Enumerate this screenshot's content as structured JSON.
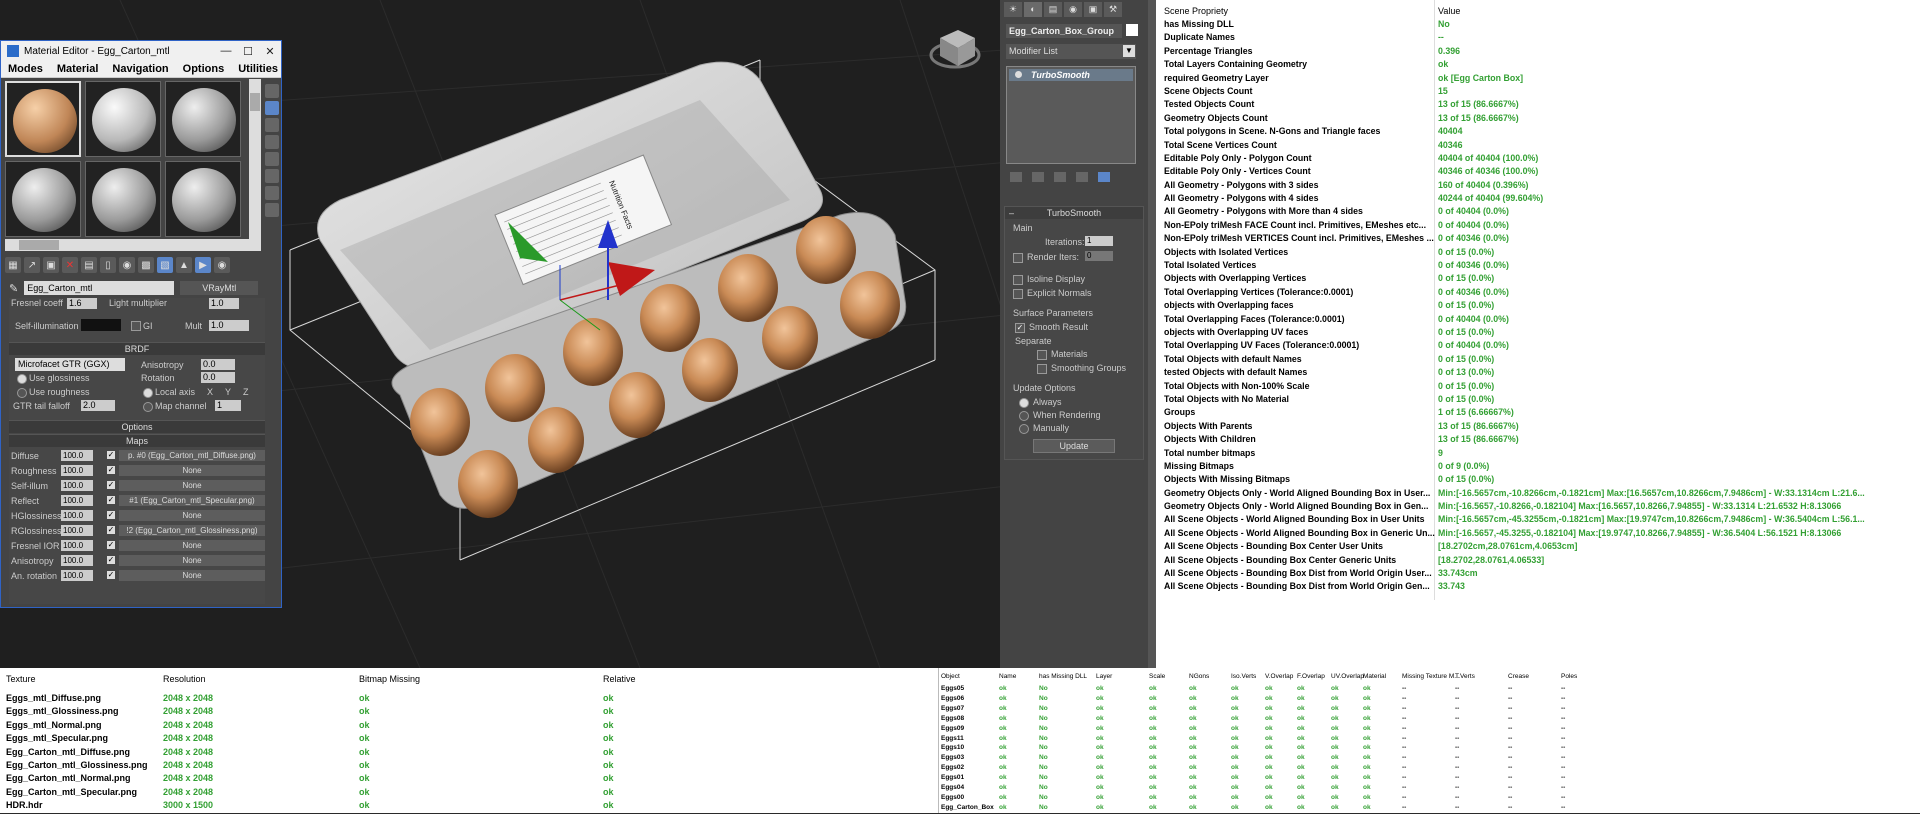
{
  "material_editor": {
    "title": "Material Editor - Egg_Carton_mtl",
    "menu": [
      "Modes",
      "Material",
      "Navigation",
      "Options",
      "Utilities"
    ],
    "material_name": "Egg_Carton_mtl",
    "material_type": "VRayMtl",
    "top_partial_labels": [
      "Fresnel coeff",
      "Light multiplier"
    ],
    "top_partial_values": [
      "1.6",
      "1.0"
    ],
    "self_illum_label": "Self-illumination",
    "gi_label": "GI",
    "mult_label": "Mult",
    "mult_value": "1.0",
    "brdf": {
      "header": "BRDF",
      "type": "Microfacet GTR (GGX)",
      "use_glossiness": "Use glossiness",
      "use_roughness": "Use roughness",
      "anisotropy_label": "Anisotropy",
      "anisotropy_value": "0.0",
      "rotation_label": "Rotation",
      "rotation_value": "0.0",
      "local_axis": "Local axis",
      "axes": [
        "X",
        "Y",
        "Z"
      ],
      "gtr_label": "GTR tail falloff",
      "gtr_value": "2.0",
      "map_channel_label": "Map channel",
      "map_channel_value": "1"
    },
    "options_header": "Options",
    "maps_header": "Maps",
    "maps": [
      {
        "name": "Diffuse",
        "value": "100.0",
        "slot": "p. #0 (Egg_Carton_mtl_Diffuse.png)"
      },
      {
        "name": "Roughness",
        "value": "100.0",
        "slot": "None"
      },
      {
        "name": "Self-illum",
        "value": "100.0",
        "slot": "None"
      },
      {
        "name": "Reflect",
        "value": "100.0",
        "slot": "#1 (Egg_Carton_mtl_Specular.png)"
      },
      {
        "name": "HGlossiness",
        "value": "100.0",
        "slot": "None"
      },
      {
        "name": "RGlossiness",
        "value": "100.0",
        "slot": "!2 (Egg_Carton_mtl_Glossiness.png)"
      },
      {
        "name": "Fresnel IOR",
        "value": "100.0",
        "slot": "None"
      },
      {
        "name": "Anisotropy",
        "value": "100.0",
        "slot": "None"
      },
      {
        "name": "An. rotation",
        "value": "100.0",
        "slot": "None"
      }
    ]
  },
  "command_panel": {
    "object_name": "Egg_Carton_Box_Group",
    "modifier_list": "Modifier List",
    "modifier": "TurboSmooth",
    "rollout_title": "TurboSmooth",
    "main_label": "Main",
    "iterations_label": "Iterations:",
    "iterations_value": "1",
    "render_iters_label": "Render Iters:",
    "render_iters_value": "0",
    "isoline_label": "Isoline Display",
    "explicit_normals_label": "Explicit Normals",
    "surface_params_label": "Surface Parameters",
    "smooth_result_label": "Smooth Result",
    "separate_label": "Separate",
    "materials_label": "Materials",
    "smoothing_groups_label": "Smoothing Groups",
    "update_options_label": "Update Options",
    "always_label": "Always",
    "when_rendering_label": "When Rendering",
    "manually_label": "Manually",
    "update_button": "Update"
  },
  "scene_properties": {
    "col_property": "Scene Propriety",
    "col_value": "Value",
    "rows": [
      [
        "has Missing DLL",
        "No"
      ],
      [
        "Duplicate Names",
        "--"
      ],
      [
        "Percentage Triangles",
        "0.396"
      ],
      [
        "Total Layers Containing Geometry",
        "ok"
      ],
      [
        "required Geometry Layer",
        "ok [Egg Carton Box]"
      ],
      [
        "Scene Objects Count",
        "15"
      ],
      [
        "Tested Objects Count",
        "13 of 15 (86.6667%)"
      ],
      [
        "Geometry Objects Count",
        "13 of 15 (86.6667%)"
      ],
      [
        "Total polygons in Scene. N-Gons and Triangle faces",
        "40404"
      ],
      [
        "Total Scene Vertices Count",
        "40346"
      ],
      [
        "Editable Poly Only - Polygon Count",
        "40404 of 40404 (100.0%)"
      ],
      [
        "Editable Poly Only - Vertices Count",
        "40346 of 40346 (100.0%)"
      ],
      [
        "All Geometry - Polygons with 3 sides",
        "160 of 40404 (0.396%)"
      ],
      [
        "All Geometry - Polygons with 4 sides",
        "40244 of 40404 (99.604%)"
      ],
      [
        "All Geometry - Polygons with More than 4 sides",
        "0 of 40404 (0.0%)"
      ],
      [
        "Non-EPoly triMesh FACE Count incl. Primitives, EMeshes etc...",
        "0 of 40404 (0.0%)"
      ],
      [
        "Non-EPoly triMesh VERTICES Count incl. Primitives, EMeshes ...",
        "0 of 40346 (0.0%)"
      ],
      [
        "Objects with Isolated Vertices",
        "0 of 15 (0.0%)"
      ],
      [
        "Total Isolated Vertices",
        "0 of 40346 (0.0%)"
      ],
      [
        "Objects with Overlapping Vertices",
        "0 of 15 (0.0%)"
      ],
      [
        "Total Overlapping Vertices (Tolerance:0.0001)",
        "0 of 40346 (0.0%)"
      ],
      [
        "objects with Overlapping faces",
        "0 of 15 (0.0%)"
      ],
      [
        "Total Overlapping Faces (Tolerance:0.0001)",
        "0 of 40404 (0.0%)"
      ],
      [
        "objects with Overlapping UV faces",
        "0 of 15 (0.0%)"
      ],
      [
        "Total Overlapping UV Faces (Tolerance:0.0001)",
        "0 of 40404 (0.0%)"
      ],
      [
        "Total Objects with default Names",
        "0 of 15 (0.0%)"
      ],
      [
        "tested Objects with default Names",
        "0 of 13 (0.0%)"
      ],
      [
        "Total Objects with Non-100% Scale",
        "0 of 15 (0.0%)"
      ],
      [
        "Total Objects with No Material",
        "0 of 15 (0.0%)"
      ],
      [
        "Groups",
        "1 of 15 (6.66667%)"
      ],
      [
        "Objects With Parents",
        "13 of 15 (86.6667%)"
      ],
      [
        "Objects With Children",
        "13 of 15 (86.6667%)"
      ],
      [
        "Total number bitmaps",
        "9"
      ],
      [
        "Missing Bitmaps",
        "0 of 9 (0.0%)"
      ],
      [
        "Objects With Missing Bitmaps",
        "0 of 15 (0.0%)"
      ],
      [
        "Geometry Objects Only - World Aligned Bounding Box in User...",
        "Min:[-16.5657cm,-10.8266cm,-0.1821cm]  Max:[16.5657cm,10.8266cm,7.9486cm] - W:33.1314cm L:21.6..."
      ],
      [
        "Geometry Objects Only - World Aligned Bounding Box in Gen...",
        "Min:[-16.5657,-10.8266,-0.182104]  Max:[16.5657,10.8266,7.94855] - W:33.1314 L:21.6532 H:8.13066"
      ],
      [
        "All Scene Objects - World Aligned Bounding Box in User Units",
        "Min:[-16.5657cm,-45.3255cm,-0.1821cm]  Max:[19.9747cm,10.8266cm,7.9486cm] - W:36.5404cm L:56.1..."
      ],
      [
        "All Scene Objects - World Aligned Bounding Box in Generic Un...",
        "Min:[-16.5657,-45.3255,-0.182104]  Max:[19.9747,10.8266,7.94855] - W:36.5404 L:56.1521 H:8.13066"
      ],
      [
        "All Scene Objects - Bounding Box Center User Units",
        "[18.2702cm,28.0761cm,4.0653cm]"
      ],
      [
        "All Scene Objects - Bounding Box Center Generic Units",
        "[18.2702,28.0761,4.06533]"
      ],
      [
        "All Scene Objects - Bounding Box Dist from World Origin User...",
        "33.743cm"
      ],
      [
        "All Scene Objects - Bounding Box Dist from World Origin Gen...",
        "33.743"
      ]
    ]
  },
  "textures": {
    "headers": [
      "Texture",
      "Resolution",
      "Bitmap Missing",
      "Relative"
    ],
    "rows": [
      [
        "Eggs_mtl_Diffuse.png",
        "2048 x 2048",
        "ok",
        "ok"
      ],
      [
        "Eggs_mtl_Glossiness.png",
        "2048 x 2048",
        "ok",
        "ok"
      ],
      [
        "Eggs_mtl_Normal.png",
        "2048 x 2048",
        "ok",
        "ok"
      ],
      [
        "Eggs_mtl_Specular.png",
        "2048 x 2048",
        "ok",
        "ok"
      ],
      [
        "Egg_Carton_mtl_Diffuse.png",
        "2048 x 2048",
        "ok",
        "ok"
      ],
      [
        "Egg_Carton_mtl_Glossiness.png",
        "2048 x 2048",
        "ok",
        "ok"
      ],
      [
        "Egg_Carton_mtl_Normal.png",
        "2048 x 2048",
        "ok",
        "ok"
      ],
      [
        "Egg_Carton_mtl_Specular.png",
        "2048 x 2048",
        "ok",
        "ok"
      ],
      [
        "HDR.hdr",
        "3000 x 1500",
        "ok",
        "ok"
      ]
    ]
  },
  "objects": {
    "headers": [
      "Object",
      "Name",
      "has Missing DLL",
      "Layer",
      "Scale",
      "NGons",
      "Iso.Verts",
      "V.Overlap",
      "F.Overlap",
      "UV.Overlap",
      "Material",
      "Missing Texture M...",
      "T.Verts",
      "Crease",
      "Poles"
    ],
    "rows": [
      [
        "Eggs05",
        "ok",
        "No",
        "ok",
        "ok",
        "ok",
        "ok",
        "ok",
        "ok",
        "ok",
        "ok",
        "--",
        "--",
        "--",
        "--"
      ],
      [
        "Eggs06",
        "ok",
        "No",
        "ok",
        "ok",
        "ok",
        "ok",
        "ok",
        "ok",
        "ok",
        "ok",
        "--",
        "--",
        "--",
        "--"
      ],
      [
        "Eggs07",
        "ok",
        "No",
        "ok",
        "ok",
        "ok",
        "ok",
        "ok",
        "ok",
        "ok",
        "ok",
        "--",
        "--",
        "--",
        "--"
      ],
      [
        "Eggs08",
        "ok",
        "No",
        "ok",
        "ok",
        "ok",
        "ok",
        "ok",
        "ok",
        "ok",
        "ok",
        "--",
        "--",
        "--",
        "--"
      ],
      [
        "Eggs09",
        "ok",
        "No",
        "ok",
        "ok",
        "ok",
        "ok",
        "ok",
        "ok",
        "ok",
        "ok",
        "--",
        "--",
        "--",
        "--"
      ],
      [
        "Eggs11",
        "ok",
        "No",
        "ok",
        "ok",
        "ok",
        "ok",
        "ok",
        "ok",
        "ok",
        "ok",
        "--",
        "--",
        "--",
        "--"
      ],
      [
        "Eggs10",
        "ok",
        "No",
        "ok",
        "ok",
        "ok",
        "ok",
        "ok",
        "ok",
        "ok",
        "ok",
        "--",
        "--",
        "--",
        "--"
      ],
      [
        "Eggs03",
        "ok",
        "No",
        "ok",
        "ok",
        "ok",
        "ok",
        "ok",
        "ok",
        "ok",
        "ok",
        "--",
        "--",
        "--",
        "--"
      ],
      [
        "Eggs02",
        "ok",
        "No",
        "ok",
        "ok",
        "ok",
        "ok",
        "ok",
        "ok",
        "ok",
        "ok",
        "--",
        "--",
        "--",
        "--"
      ],
      [
        "Eggs01",
        "ok",
        "No",
        "ok",
        "ok",
        "ok",
        "ok",
        "ok",
        "ok",
        "ok",
        "ok",
        "--",
        "--",
        "--",
        "--"
      ],
      [
        "Eggs04",
        "ok",
        "No",
        "ok",
        "ok",
        "ok",
        "ok",
        "ok",
        "ok",
        "ok",
        "ok",
        "--",
        "--",
        "--",
        "--"
      ],
      [
        "Eggs00",
        "ok",
        "No",
        "ok",
        "ok",
        "ok",
        "ok",
        "ok",
        "ok",
        "ok",
        "ok",
        "--",
        "--",
        "--",
        "--"
      ],
      [
        "Egg_Carton_Box",
        "ok",
        "No",
        "ok",
        "ok",
        "ok",
        "ok",
        "ok",
        "ok",
        "ok",
        "ok",
        "--",
        "--",
        "--",
        "--"
      ]
    ]
  },
  "viewport": {
    "label_title": "Nutrition Facts"
  },
  "colors": {
    "ok_green": "#33a033",
    "accent_blue": "#2f63c6"
  }
}
